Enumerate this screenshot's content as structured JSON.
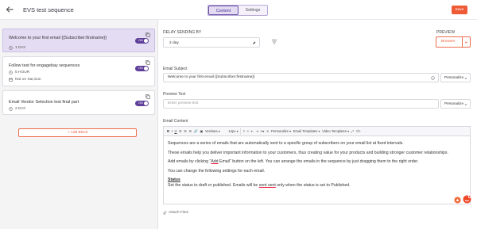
{
  "header": {
    "title": "EVS test sequence",
    "tabs": [
      {
        "label": "Content",
        "active": true
      },
      {
        "label": "Settings",
        "active": false
      }
    ],
    "save_label": "Save",
    "accent_color": "#ef5b36",
    "brand_color": "#5e3f99"
  },
  "sidebar": {
    "emails": [
      {
        "title": "Welcome to your first email {{Subscriber:firstname}}",
        "delay": "1 DAY",
        "schedule": null,
        "toggle": "ON",
        "selected": true
      },
      {
        "title": "Follow test for engagebay sequences",
        "delay": "5 HOUR",
        "schedule": "Not on Sat,Sun",
        "toggle": "ON",
        "selected": false
      },
      {
        "title": "Email Vendor Selection test final part",
        "delay": "2 DAY",
        "schedule": null,
        "toggle": "ON",
        "selected": false
      }
    ],
    "add_block_label": "+ Add Block"
  },
  "main": {
    "delay_label": "DELAY SENDING BY",
    "delay_value": "2 day",
    "preview_label": "PREVIEW",
    "browser_label": "Browser",
    "subject_label": "Email Subject",
    "subject_value": "Welcome to your first email {{Subscriber:firstname}}",
    "personalize_label": "Personalize",
    "preview_text_label": "Preview Text",
    "preview_text_placeholder": "Enter preview text",
    "content_label": "Email Content",
    "toolbar": {
      "font": "Verdana",
      "size": "14px",
      "personalize": "Personalize",
      "email_templates": "Email Templates",
      "video_templates": "Video Templates"
    },
    "body": {
      "p1": "Sequences are a series of emails that are automatically sent to a specific group of subscribers on your email list at fixed intervals.",
      "p2": "These emails help you deliver important information to your customers, thus creating value for your products and building stronger customer relationships.",
      "p3a": "Add emails by clicking \"",
      "p3b": "Add",
      "p3c": " Email\" button on the left. You can arrange the emails in the sequence by just dragging them to the right order.",
      "p4": "You can change the following settings for each email.",
      "status_heading": "Status",
      "p5a": "Set the status to draft or published. Emails will be ",
      "p5b": "sent sent",
      "p5c": " only when the status is set to Published."
    },
    "attach_label": "Attach Files"
  }
}
